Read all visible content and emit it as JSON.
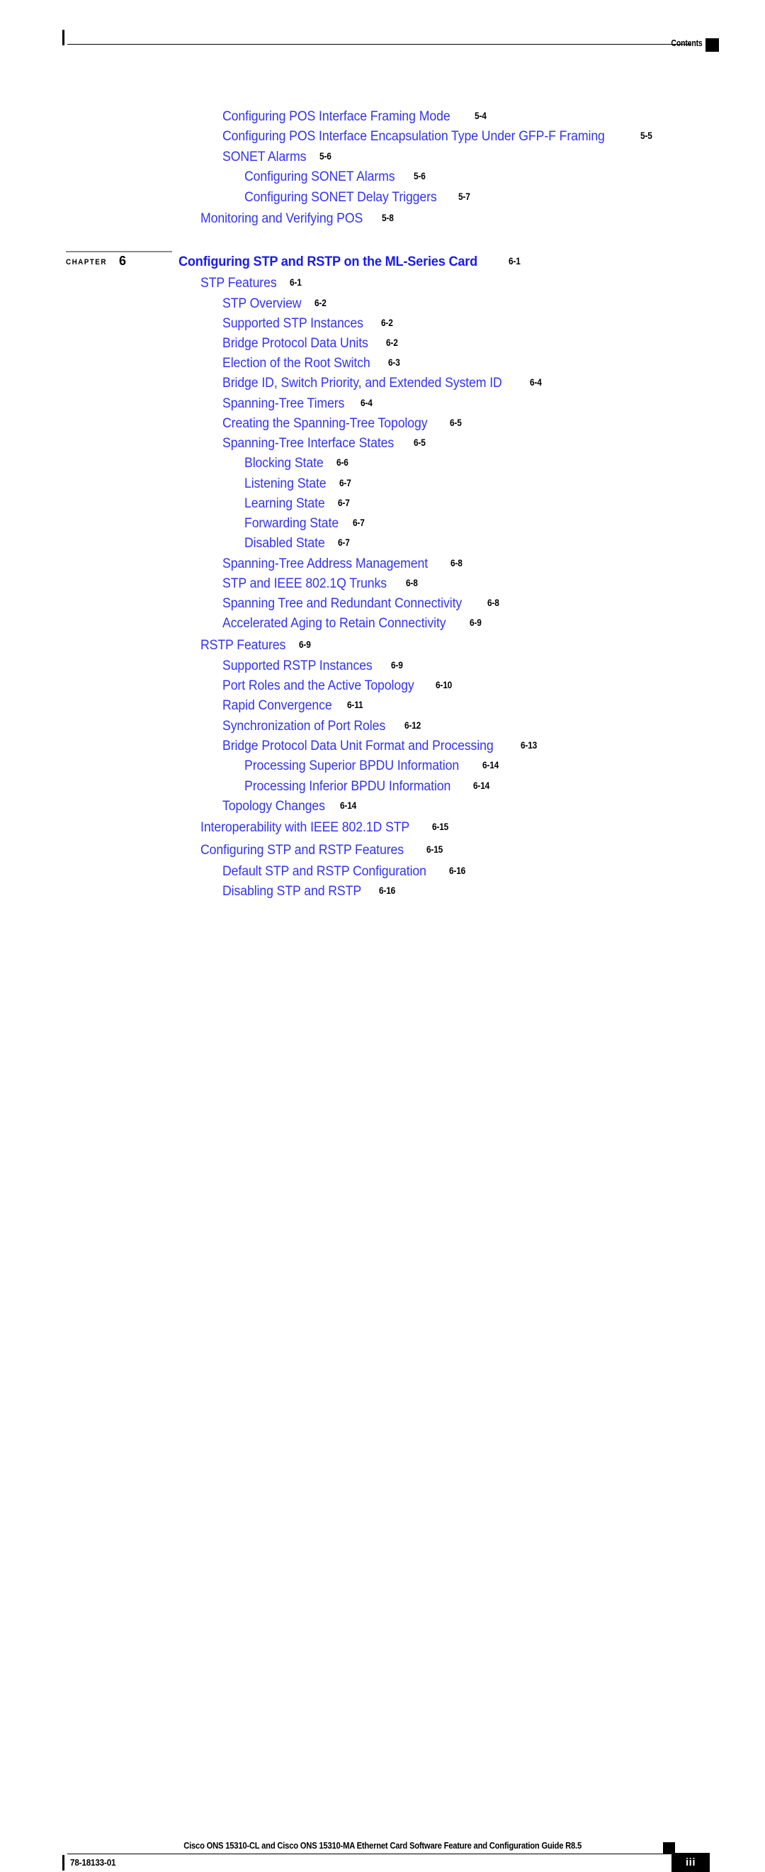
{
  "header": {
    "label": "Contents"
  },
  "chapter": {
    "word": "CHAPTER",
    "number": "6",
    "title": "Configuring STP and RSTP on the ML-Series Card",
    "page": "6-1"
  },
  "toc": {
    "entries": [
      {
        "title": "Configuring POS Interface Framing Mode",
        "page": "5-4",
        "level": 2
      },
      {
        "title": "Configuring POS Interface Encapsulation Type Under GFP-F Framing",
        "page": "5-5",
        "level": 2
      },
      {
        "title": "SONET Alarms",
        "page": "5-6",
        "level": 2
      },
      {
        "title": "Configuring SONET Alarms",
        "page": "5-6",
        "level": 3
      },
      {
        "title": "Configuring SONET Delay Triggers",
        "page": "5-7",
        "level": 3
      },
      {
        "title": "Monitoring and Verifying POS",
        "page": "5-8",
        "level": 1
      },
      {
        "title": "STP Features",
        "page": "6-1",
        "level": 1
      },
      {
        "title": "STP Overview",
        "page": "6-2",
        "level": 2
      },
      {
        "title": "Supported STP Instances",
        "page": "6-2",
        "level": 2
      },
      {
        "title": "Bridge Protocol Data Units",
        "page": "6-2",
        "level": 2
      },
      {
        "title": "Election of the Root Switch",
        "page": "6-3",
        "level": 2
      },
      {
        "title": "Bridge ID, Switch Priority, and Extended System ID",
        "page": "6-4",
        "level": 2
      },
      {
        "title": "Spanning-Tree Timers",
        "page": "6-4",
        "level": 2
      },
      {
        "title": "Creating the Spanning-Tree Topology",
        "page": "6-5",
        "level": 2
      },
      {
        "title": "Spanning-Tree Interface States",
        "page": "6-5",
        "level": 2
      },
      {
        "title": "Blocking State",
        "page": "6-6",
        "level": 3
      },
      {
        "title": "Listening State",
        "page": "6-7",
        "level": 3
      },
      {
        "title": "Learning State",
        "page": "6-7",
        "level": 3
      },
      {
        "title": "Forwarding State",
        "page": "6-7",
        "level": 3
      },
      {
        "title": "Disabled State",
        "page": "6-7",
        "level": 3
      },
      {
        "title": "Spanning-Tree Address Management",
        "page": "6-8",
        "level": 2
      },
      {
        "title": "STP and IEEE 802.1Q Trunks",
        "page": "6-8",
        "level": 2
      },
      {
        "title": "Spanning Tree and Redundant Connectivity",
        "page": "6-8",
        "level": 2
      },
      {
        "title": "Accelerated Aging to Retain Connectivity",
        "page": "6-9",
        "level": 2
      },
      {
        "title": "RSTP Features",
        "page": "6-9",
        "level": 1
      },
      {
        "title": "Supported RSTP Instances",
        "page": "6-9",
        "level": 2
      },
      {
        "title": "Port Roles and the Active Topology",
        "page": "6-10",
        "level": 2
      },
      {
        "title": "Rapid Convergence",
        "page": "6-11",
        "level": 2
      },
      {
        "title": "Synchronization of Port Roles",
        "page": "6-12",
        "level": 2
      },
      {
        "title": "Bridge Protocol Data Unit Format and Processing",
        "page": "6-13",
        "level": 2
      },
      {
        "title": "Processing Superior BPDU Information",
        "page": "6-14",
        "level": 3
      },
      {
        "title": "Processing Inferior BPDU Information",
        "page": "6-14",
        "level": 3
      },
      {
        "title": "Topology Changes",
        "page": "6-14",
        "level": 2
      },
      {
        "title": "Interoperability with IEEE 802.1D STP",
        "page": "6-15",
        "level": 1
      },
      {
        "title": "Configuring STP and RSTP Features",
        "page": "6-15",
        "level": 1
      },
      {
        "title": "Default STP and RSTP Configuration",
        "page": "6-16",
        "level": 2
      },
      {
        "title": "Disabling STP and RSTP",
        "page": "6-16",
        "level": 2
      }
    ]
  },
  "footer": {
    "title": "Cisco ONS 15310-CL and Cisco ONS 15310-MA Ethernet Card Software Feature and Configuration Guide R8.5",
    "doc_id": "78-18133-01",
    "page_number": "iii"
  },
  "colors": {
    "link_blue": "#3333ee",
    "chapter_blue": "#1a1aee",
    "rule_gray": "#8c8c8c",
    "text_black": "#000000"
  }
}
